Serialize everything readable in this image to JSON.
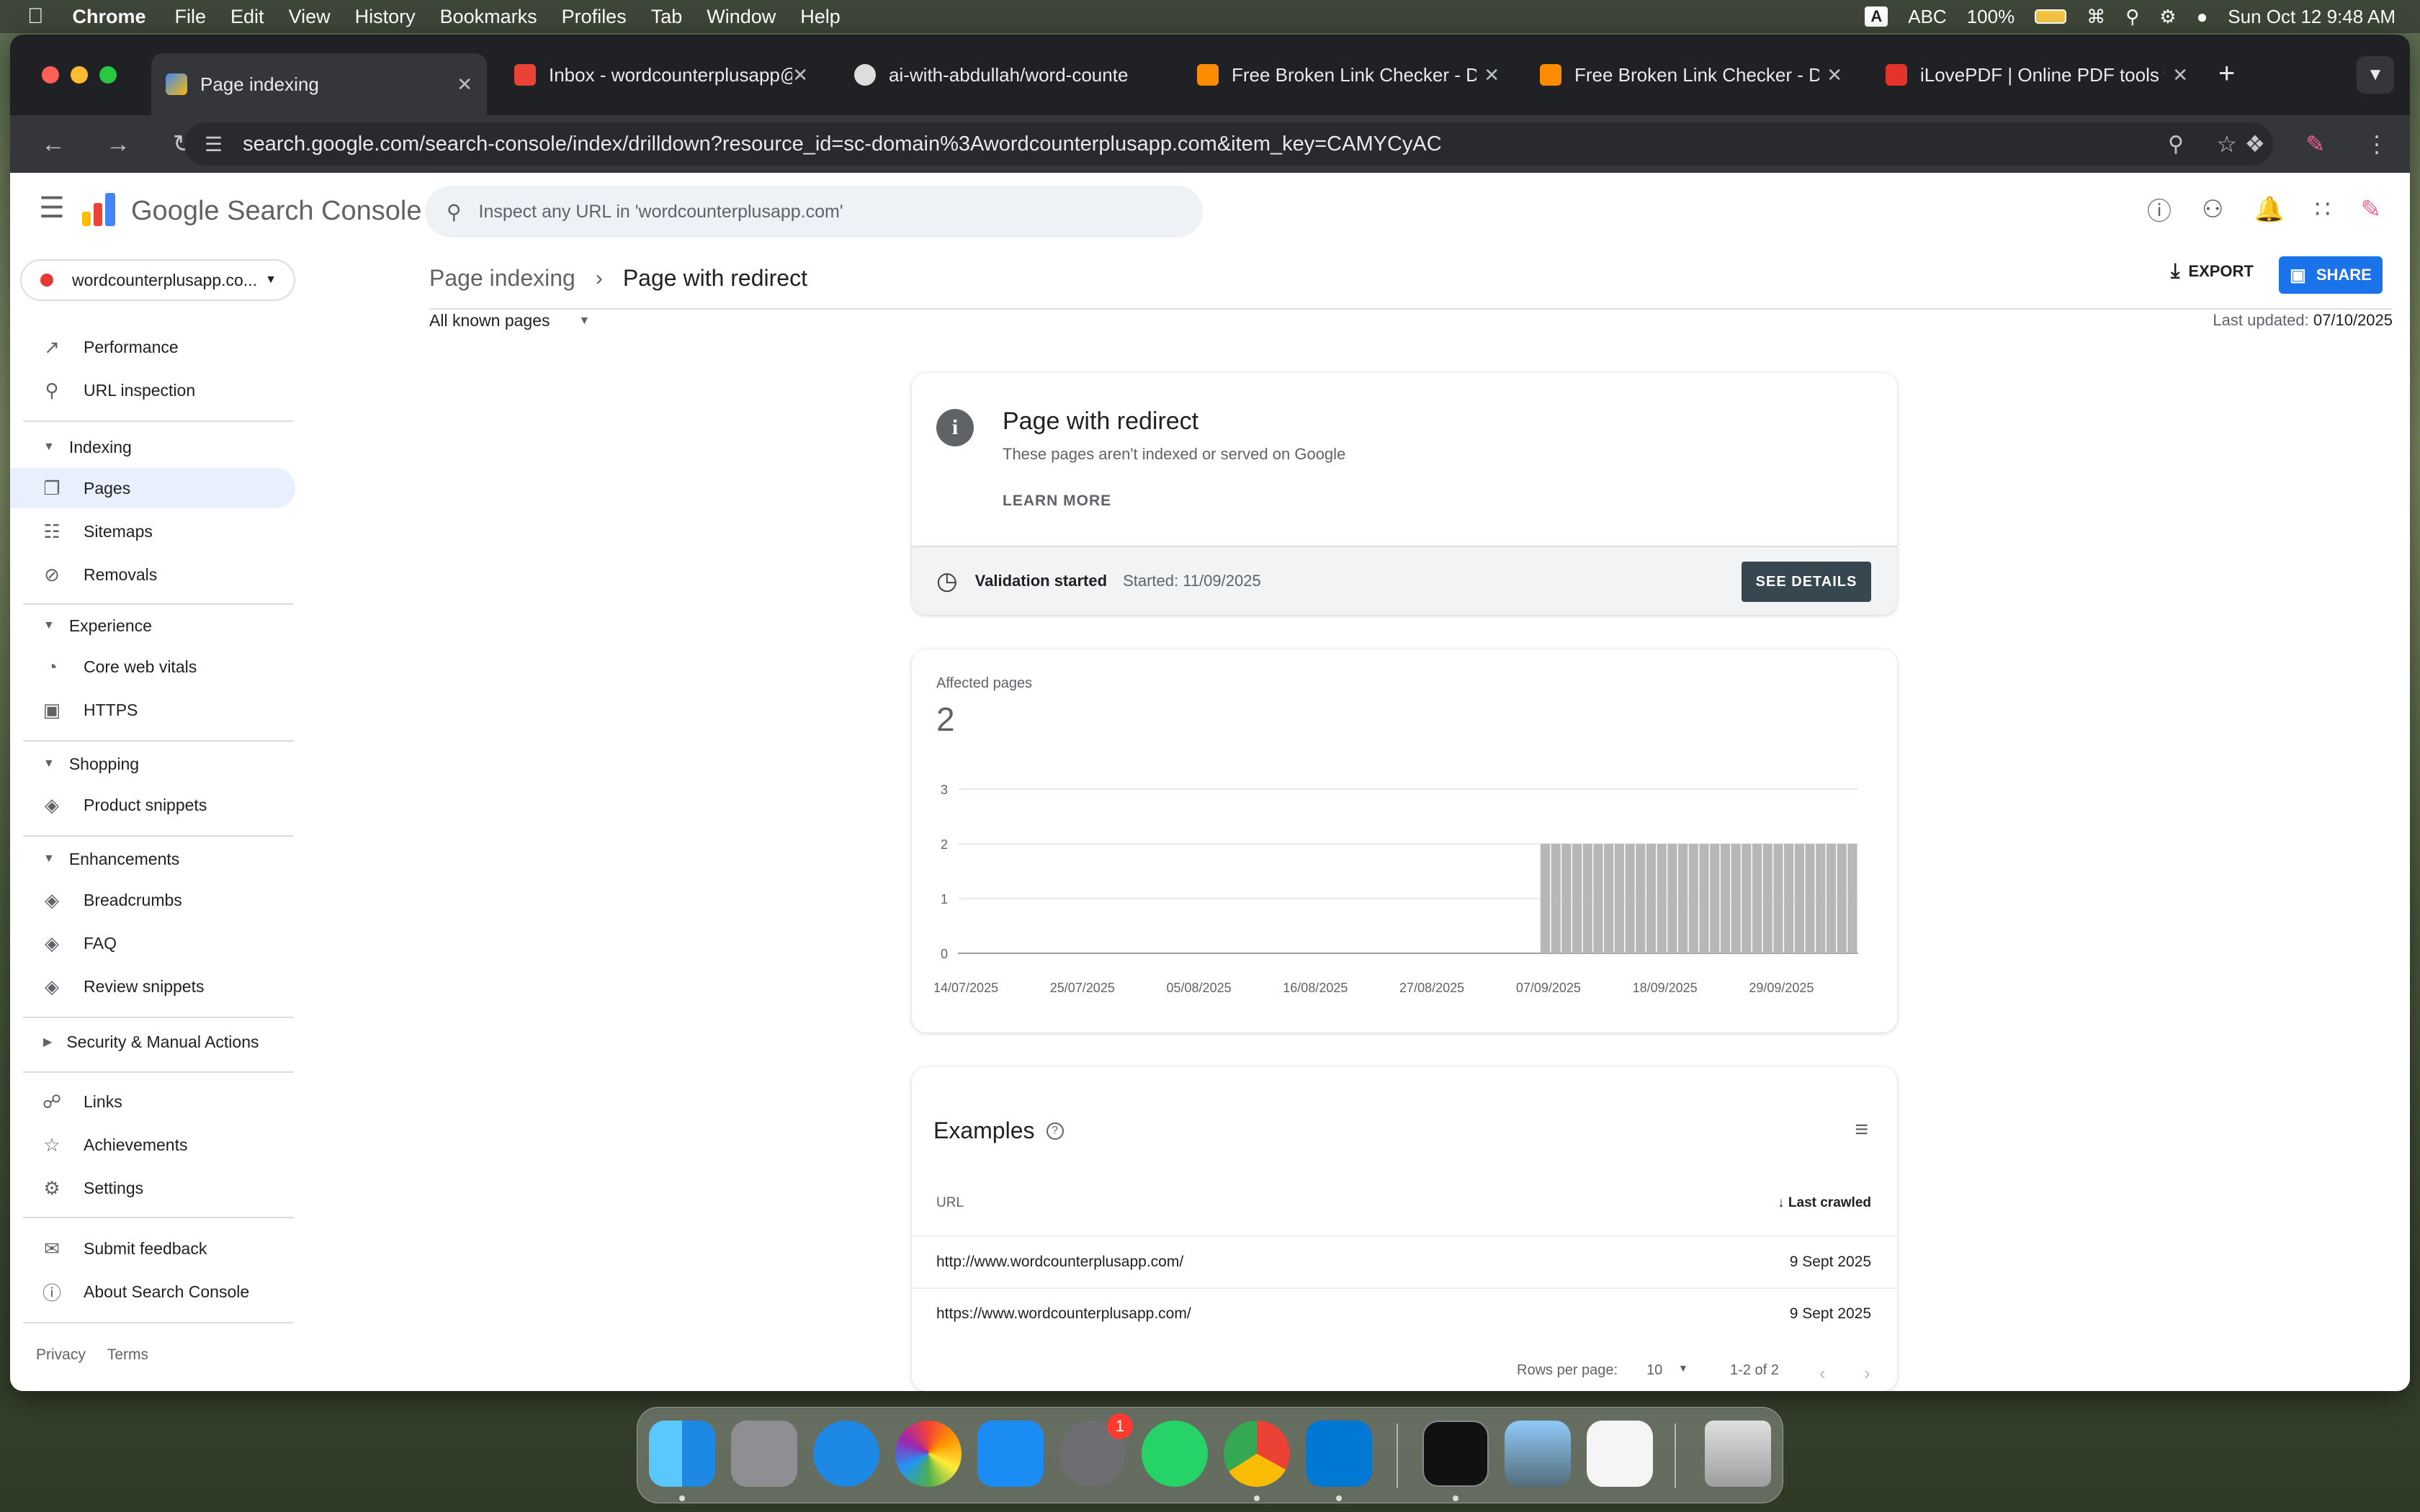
{
  "menubar": {
    "app": "Chrome",
    "items": [
      "File",
      "Edit",
      "View",
      "History",
      "Bookmarks",
      "Profiles",
      "Tab",
      "Window",
      "Help"
    ],
    "input_badge": "A",
    "input_source": "ABC",
    "battery": "100%",
    "datetime": "Sun Oct 12  9:48 AM"
  },
  "tabs": [
    {
      "title": "Page indexing",
      "active": true
    },
    {
      "title": "Inbox - wordcounterplusapp@",
      "active": false
    },
    {
      "title": "ai-with-abdullah/word-counte",
      "active": false
    },
    {
      "title": "Free Broken Link Checker - D",
      "active": false
    },
    {
      "title": "Free Broken Link Checker - D",
      "active": false
    },
    {
      "title": "iLovePDF | Online PDF tools fo",
      "active": false
    }
  ],
  "toolbar": {
    "url": "search.google.com/search-console/index/drilldown?resource_id=sc-domain%3Awordcounterplusapp.com&item_key=CAMYCyAC"
  },
  "header": {
    "title": "Google Search Console",
    "search_placeholder": "Inspect any URL in 'wordcounterplusapp.com'"
  },
  "sidebar": {
    "property": "wordcounterplusapp.co...",
    "performance": "Performance",
    "url_inspection": "URL inspection",
    "indexing": "Indexing",
    "pages": "Pages",
    "sitemaps": "Sitemaps",
    "removals": "Removals",
    "experience": "Experience",
    "core_web_vitals": "Core web vitals",
    "https": "HTTPS",
    "shopping": "Shopping",
    "product_snippets": "Product snippets",
    "enhancements": "Enhancements",
    "breadcrumbs": "Breadcrumbs",
    "faq": "FAQ",
    "review_snippets": "Review snippets",
    "security": "Security & Manual Actions",
    "links": "Links",
    "achievements": "Achievements",
    "settings": "Settings",
    "submit_feedback": "Submit feedback",
    "about": "About Search Console",
    "privacy": "Privacy",
    "terms": "Terms"
  },
  "main": {
    "breadcrumb_root": "Page indexing",
    "breadcrumb_current": "Page with redirect",
    "export": "EXPORT",
    "share": "SHARE",
    "filter": "All known pages",
    "last_updated_label": "Last updated:",
    "last_updated_value": "07/10/2025",
    "issue": {
      "title": "Page with redirect",
      "subtitle": "These pages aren't indexed or served on Google",
      "learn_more": "LEARN MORE",
      "validation_title": "Validation started",
      "validation_date": "Started: 11/09/2025",
      "see_details": "SEE DETAILS"
    },
    "affected_label": "Affected pages",
    "affected_value": "2",
    "examples": {
      "title": "Examples",
      "col_url": "URL",
      "col_crawled": "Last crawled",
      "rows": [
        {
          "url": "http://www.wordcounterplusapp.com/",
          "date": "9 Sept 2025"
        },
        {
          "url": "https://www.wordcounterplusapp.com/",
          "date": "9 Sept 2025"
        }
      ],
      "rows_per_page_label": "Rows per page:",
      "rows_per_page": "10",
      "range": "1-2 of 2"
    }
  },
  "chart_data": {
    "type": "bar",
    "ylim": [
      0,
      3
    ],
    "yticks": [
      "0",
      "1",
      "2",
      "3"
    ],
    "xticks": [
      "14/07/2025",
      "25/07/2025",
      "05/08/2025",
      "16/08/2025",
      "27/08/2025",
      "07/09/2025",
      "18/09/2025",
      "29/09/2025"
    ],
    "x_start": "14/07/2025",
    "x_end": "07/10/2025",
    "series": [
      {
        "from": "07/09/2025",
        "to": "07/10/2025",
        "value": 2
      }
    ],
    "bar_color": "#b7b7b7"
  },
  "dock": {
    "settings_badge": "1"
  }
}
